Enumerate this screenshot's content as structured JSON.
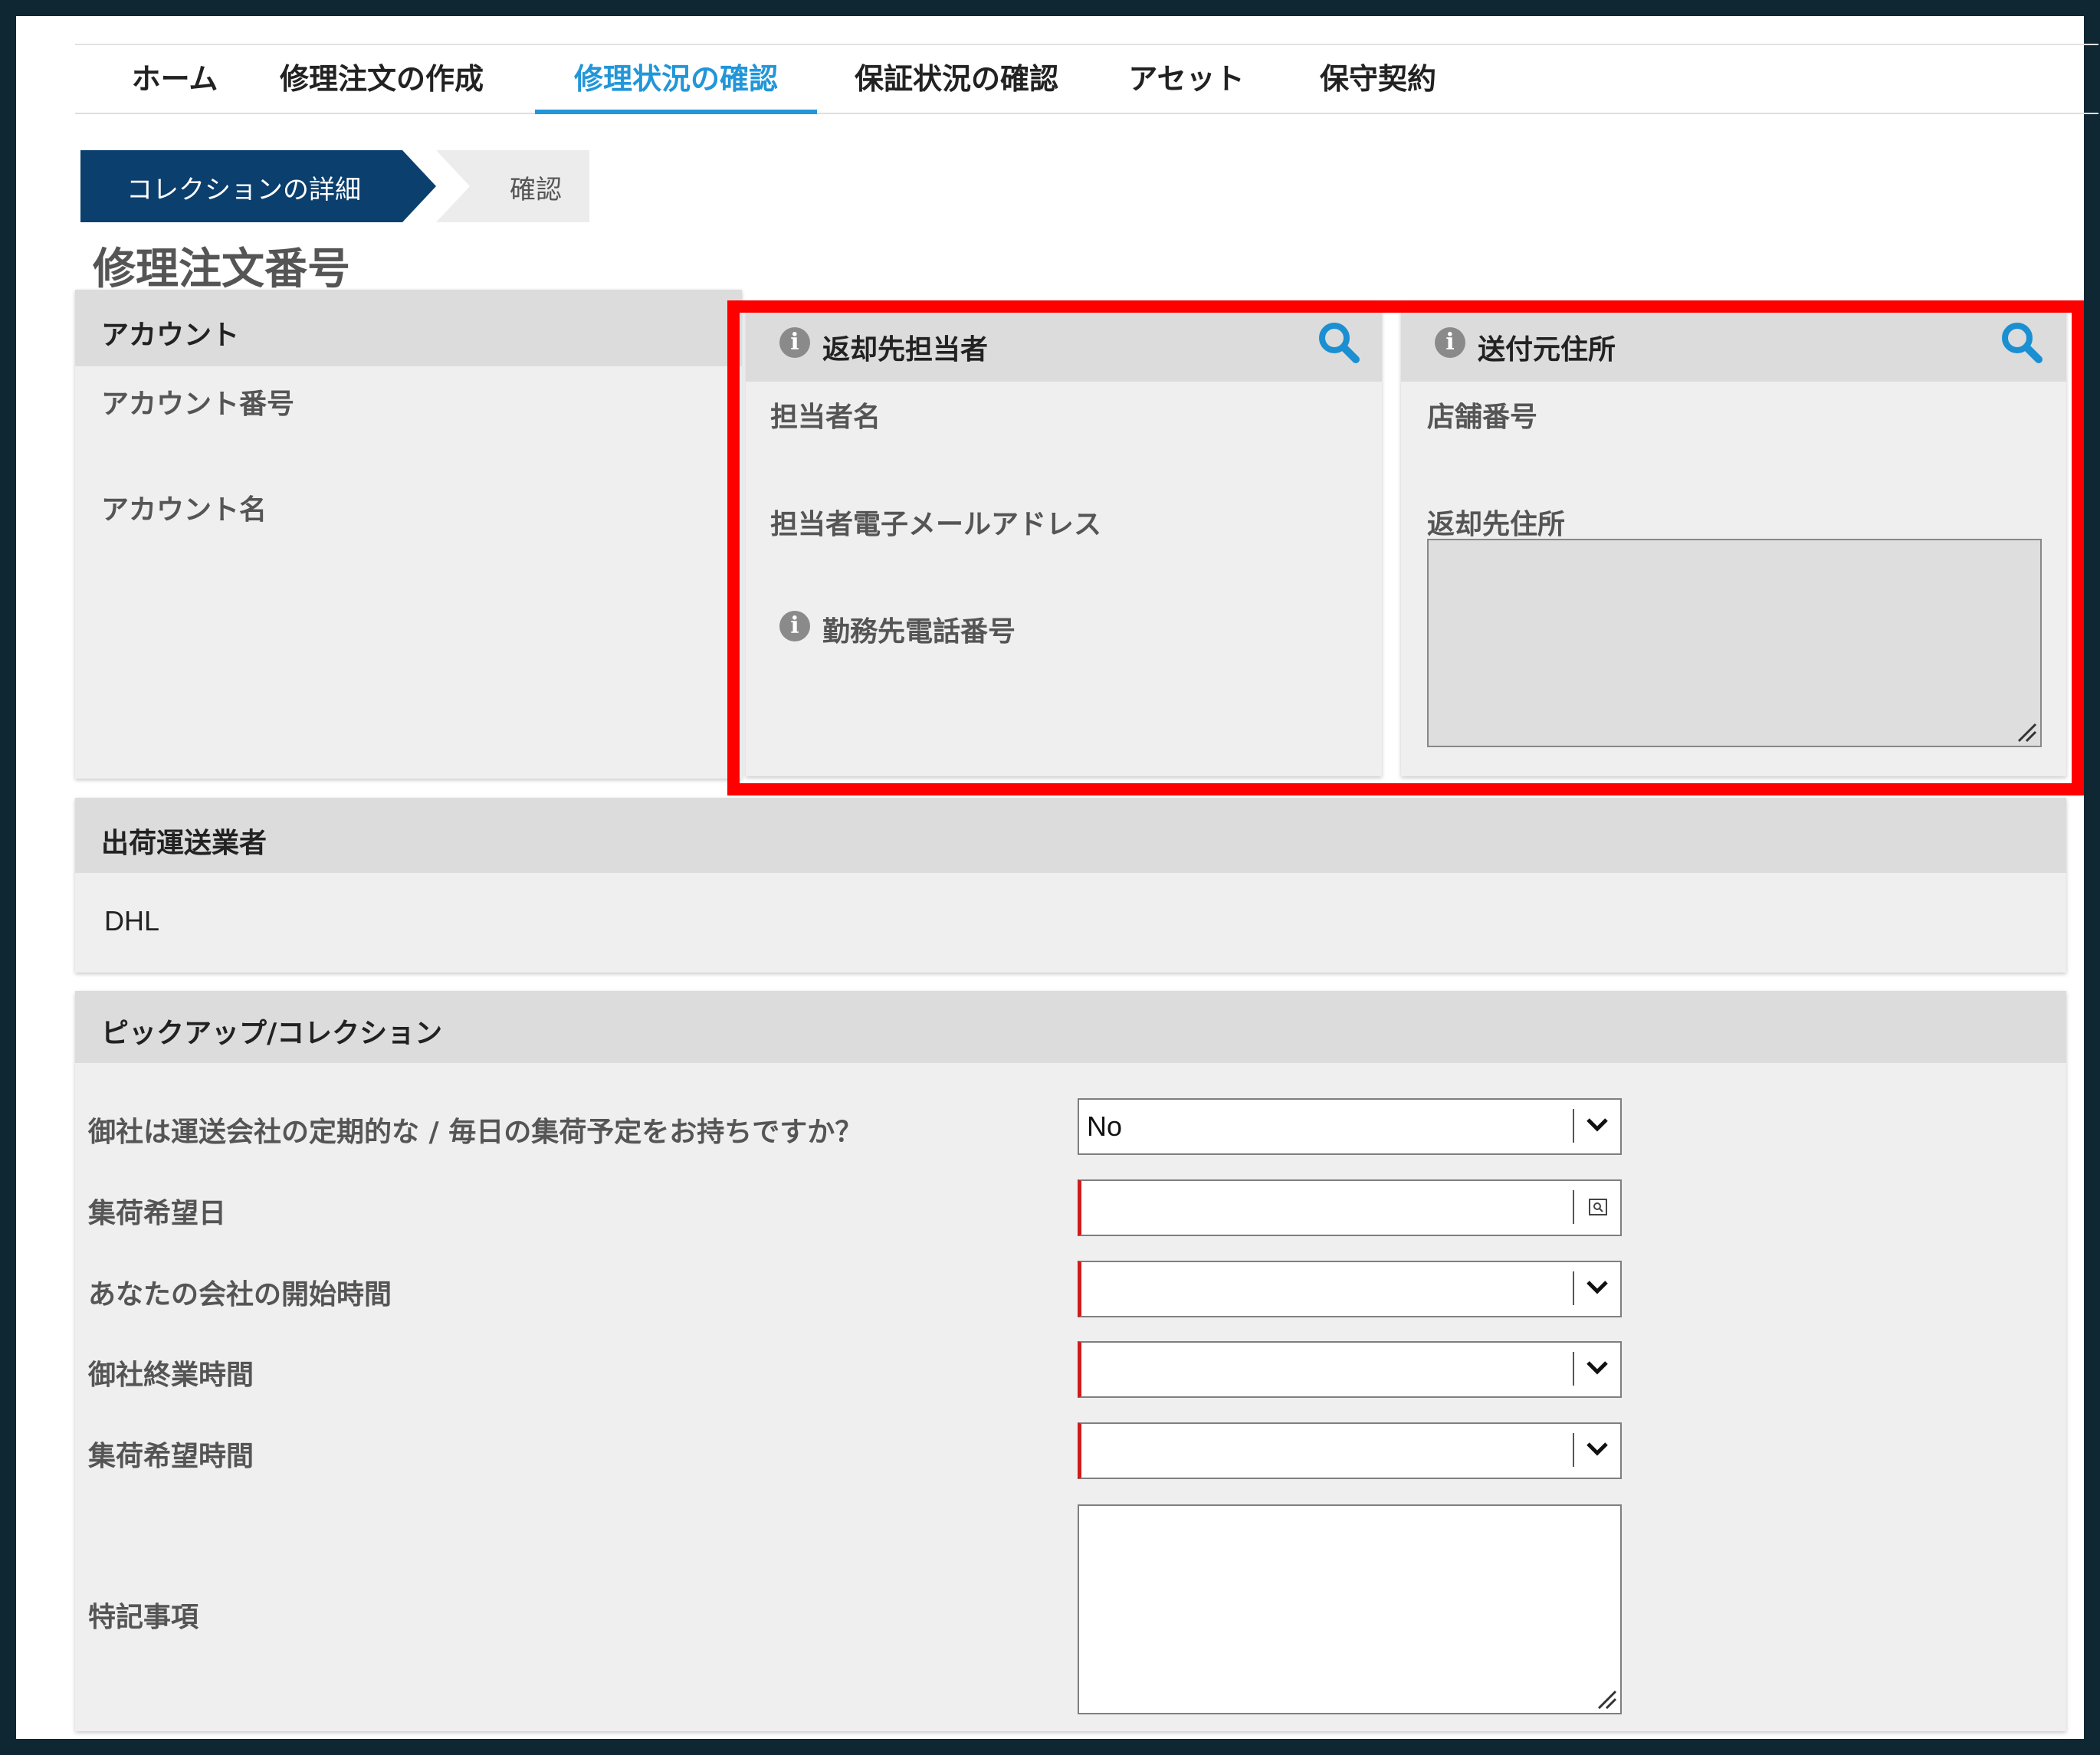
{
  "nav": {
    "tabs": [
      {
        "label": "ホーム",
        "active": false
      },
      {
        "label": "修理注文の作成",
        "active": false
      },
      {
        "label": "修理状況の確認",
        "active": true
      },
      {
        "label": "保証状況の確認",
        "active": false
      },
      {
        "label": "アセット",
        "active": false
      },
      {
        "label": "保守契約",
        "active": false
      }
    ],
    "active_color": "#2196d8"
  },
  "steps": [
    {
      "label": "コレクションの詳細",
      "state": "current",
      "color": "#0a3f6e"
    },
    {
      "label": "確認",
      "state": "upcoming"
    }
  ],
  "page_title": "修理注文番号",
  "account": {
    "title": "アカウント",
    "fields": [
      "アカウント番号",
      "アカウント名"
    ]
  },
  "return_contact": {
    "title": "返却先担当者",
    "fields": [
      "担当者名",
      "担当者電子メールアドレス",
      "勤務先電話番号"
    ]
  },
  "ship_from": {
    "title": "送付元住所",
    "fields": [
      "店舗番号",
      "返却先住所"
    ]
  },
  "carrier": {
    "title": "出荷運送業者",
    "value": "DHL"
  },
  "pickup": {
    "title": "ピックアップ/コレクション",
    "rows": [
      {
        "label": "御社は運送会社の定期的な / 毎日の集荷予定をお持ちですか？",
        "value": "No",
        "control": "select",
        "required": false
      },
      {
        "label": "集荷希望日",
        "value": "",
        "control": "date",
        "required": true
      },
      {
        "label": "あなたの会社の開始時間",
        "value": "",
        "control": "select",
        "required": true
      },
      {
        "label": "御社終業時間",
        "value": "",
        "control": "select",
        "required": true
      },
      {
        "label": "集荷希望時間",
        "value": "",
        "control": "select",
        "required": true
      },
      {
        "label": "特記事項",
        "value": "",
        "control": "textarea",
        "required": false
      }
    ]
  },
  "colors": {
    "highlight": "#ff0000",
    "frame": "#0e2733",
    "search_icon": "#1a8fd1",
    "required_marker": "#d11a1a"
  }
}
